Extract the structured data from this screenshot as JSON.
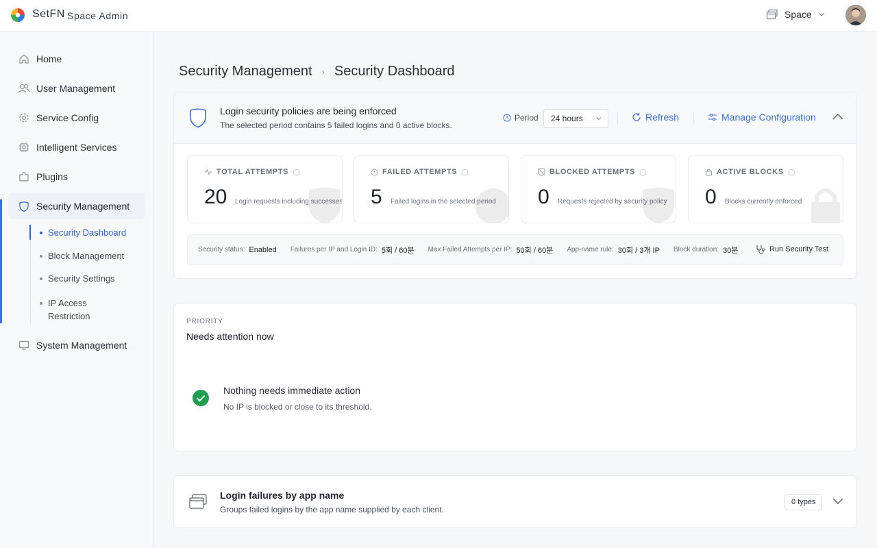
{
  "header": {
    "brand": "SetFN",
    "brand_sub": "Space Admin",
    "space_label": "Space"
  },
  "sidebar": {
    "items": [
      {
        "label": "Home",
        "icon": "home-icon"
      },
      {
        "label": "User Management",
        "icon": "users-icon"
      },
      {
        "label": "Service Config",
        "icon": "gear-icon"
      },
      {
        "label": "Intelligent Services",
        "icon": "chip-icon"
      },
      {
        "label": "Plugins",
        "icon": "puzzle-icon"
      },
      {
        "label": "Security Management",
        "icon": "shield-icon"
      },
      {
        "label": "System Management",
        "icon": "monitor-icon"
      }
    ],
    "sub_items": [
      {
        "label": "Security Dashboard"
      },
      {
        "label": "Block Management"
      },
      {
        "label": "Security Settings"
      },
      {
        "label": "IP Access Restriction"
      }
    ]
  },
  "breadcrumb": {
    "parent": "Security Management",
    "current": "Security Dashboard"
  },
  "policy_card": {
    "title": "Login security policies are being enforced",
    "subtitle": "The selected period contains 5 failed logins and 0 active blocks.",
    "period_label": "Period",
    "period_value": "24 hours",
    "refresh_label": "Refresh",
    "manage_label": "Manage Configuration",
    "stats": [
      {
        "label": "TOTAL ATTEMPTS",
        "value": "20",
        "desc": "Login requests including successes"
      },
      {
        "label": "FAILED ATTEMPTS",
        "value": "5",
        "desc": "Failed logins in the selected period"
      },
      {
        "label": "BLOCKED ATTEMPTS",
        "value": "0",
        "desc": "Requests rejected by security policy"
      },
      {
        "label": "ACTIVE BLOCKS",
        "value": "0",
        "desc": "Blocks currently enforced"
      }
    ],
    "status": {
      "security_status_key": "Security status:",
      "security_status_val": "Enabled",
      "failures_key": "Failures per IP and Login ID:",
      "failures_val": "5회 / 60분",
      "max_failed_key": "Max Failed Attempts per IP:",
      "max_failed_val": "50회 / 60분",
      "app_rule_key": "App-name rule:",
      "app_rule_val": "30회 / 3개 IP",
      "block_duration_key": "Block duration:",
      "block_duration_val": "30분",
      "run_test_label": "Run Security Test"
    }
  },
  "priority_card": {
    "eyebrow": "PRIORITY",
    "title": "Needs attention now",
    "ok_title": "Nothing needs immediate action",
    "ok_subtitle": "No IP is blocked or close to its threshold."
  },
  "app_failures_card": {
    "title": "Login failures by app name",
    "subtitle": "Groups failed logins by the app name supplied by each client.",
    "badge": "0 types"
  },
  "colors": {
    "accent": "#3b72e8",
    "success": "#1e9e4f"
  }
}
